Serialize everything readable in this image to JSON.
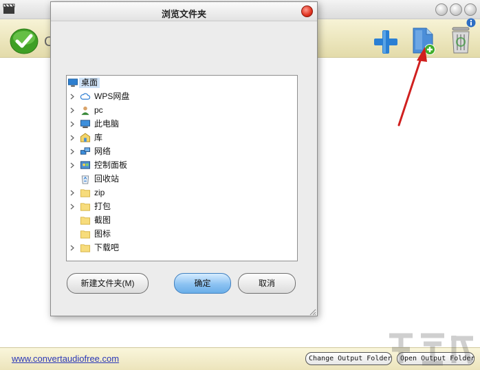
{
  "dialog": {
    "title": "浏览文件夹",
    "tree": [
      {
        "label": "桌面",
        "icon": "desktop-icon",
        "expandable": false,
        "selected": true
      },
      {
        "label": "WPS网盘",
        "icon": "cloud-icon",
        "expandable": true
      },
      {
        "label": "pc",
        "icon": "user-icon",
        "expandable": true
      },
      {
        "label": "此电脑",
        "icon": "computer-icon",
        "expandable": true
      },
      {
        "label": "库",
        "icon": "library-icon",
        "expandable": true
      },
      {
        "label": "网络",
        "icon": "network-icon",
        "expandable": true
      },
      {
        "label": "控制面板",
        "icon": "control-panel-icon",
        "expandable": true
      },
      {
        "label": "回收站",
        "icon": "recycle-bin-icon",
        "expandable": false
      },
      {
        "label": "zip",
        "icon": "folder-icon",
        "expandable": true
      },
      {
        "label": "打包",
        "icon": "folder-icon",
        "expandable": true
      },
      {
        "label": "截图",
        "icon": "folder-icon",
        "expandable": false
      },
      {
        "label": "图标",
        "icon": "folder-icon",
        "expandable": false
      },
      {
        "label": "下载吧",
        "icon": "folder-icon",
        "expandable": true
      }
    ],
    "new_folder_label": "新建文件夹(M)",
    "ok_label": "确定",
    "cancel_label": "取消"
  },
  "toolbar": {
    "partial_label": "C",
    "icons": [
      "check-icon",
      "plus-icon",
      "add-file-icon",
      "trash-icon",
      "info-icon"
    ]
  },
  "statusbar": {
    "website": "www.convertaudiofree.com",
    "change_output_label": "Change Output Folder",
    "open_output_label": "Open Output Folder"
  },
  "colors": {
    "toolbar_bg": "#ece6bd",
    "link": "#2a37b8",
    "arrow": "#d0201f",
    "ok_button": "#8cc2f2",
    "check_green": "#4cb32e",
    "plus_blue": "#2a7fd4"
  }
}
